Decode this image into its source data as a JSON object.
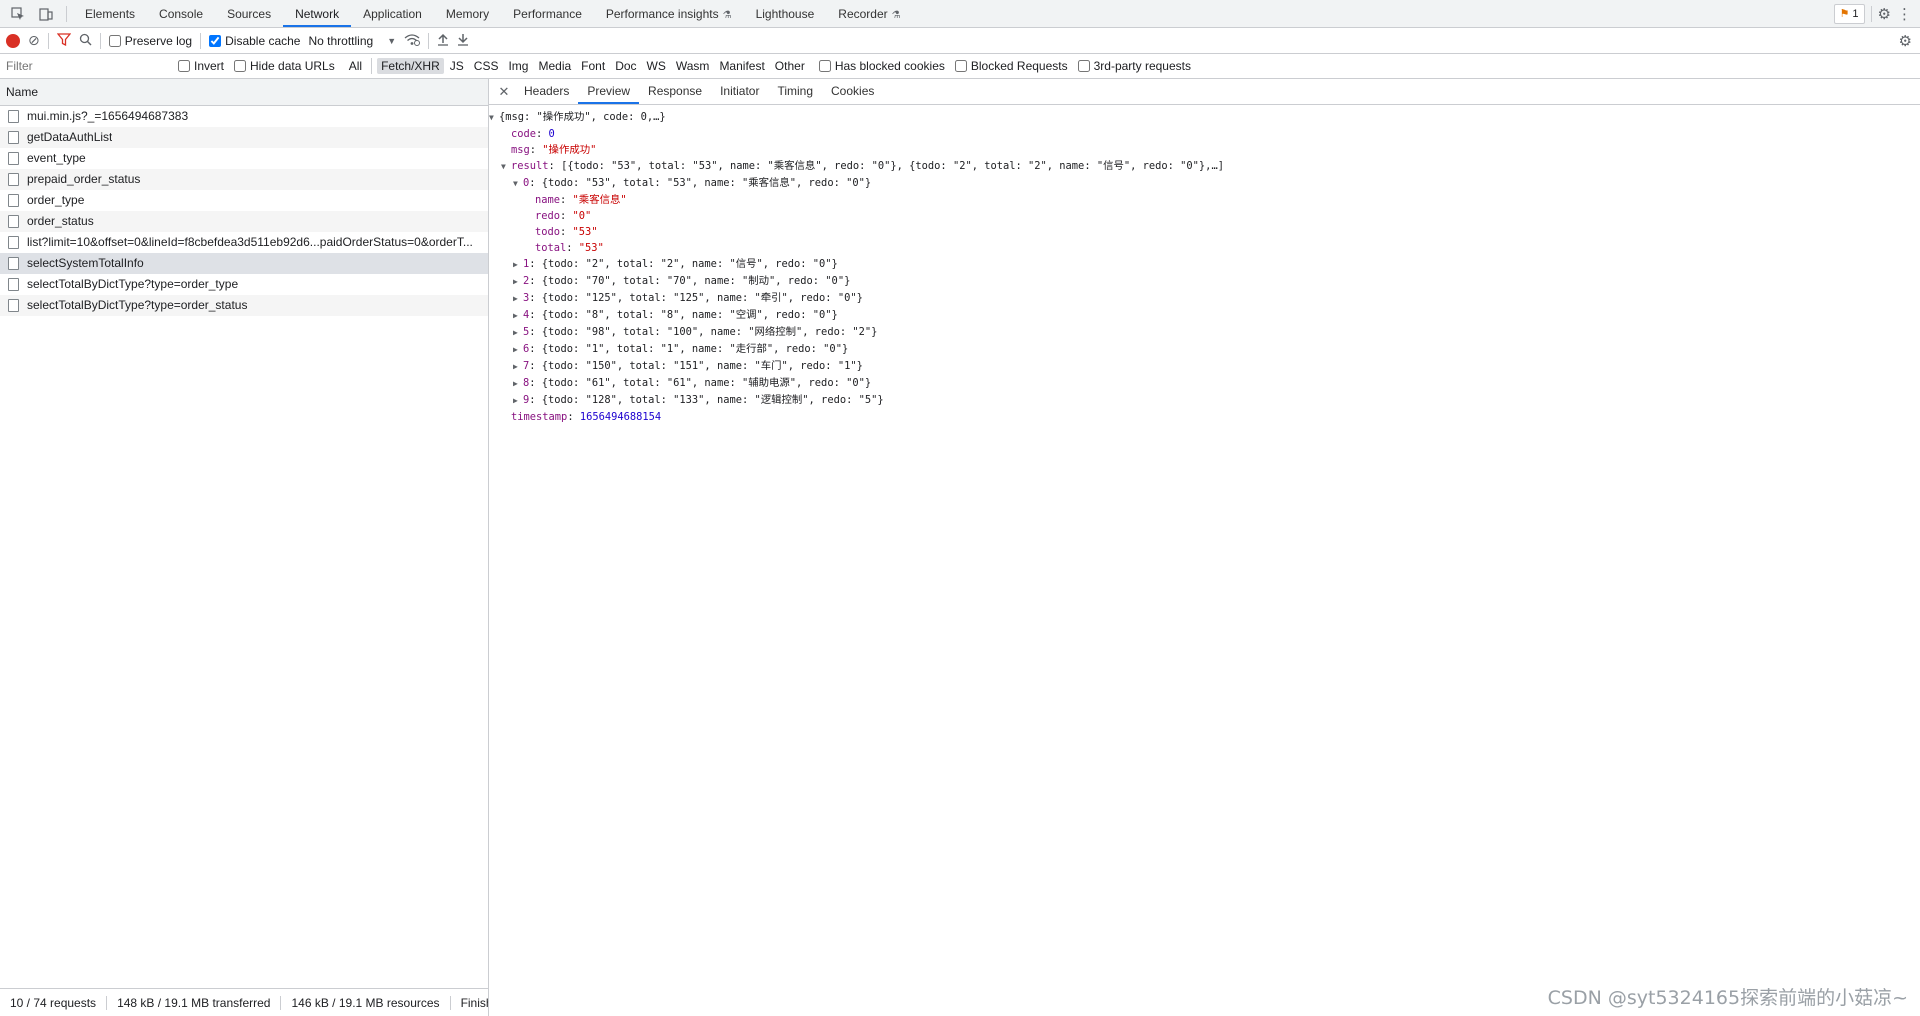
{
  "tabs": [
    {
      "label": "Elements"
    },
    {
      "label": "Console"
    },
    {
      "label": "Sources"
    },
    {
      "label": "Network",
      "active": true
    },
    {
      "label": "Application"
    },
    {
      "label": "Memory"
    },
    {
      "label": "Performance"
    },
    {
      "label": "Performance insights",
      "beta": true
    },
    {
      "label": "Lighthouse"
    },
    {
      "label": "Recorder",
      "beta": true
    }
  ],
  "issues_count": "1",
  "toolbar": {
    "preserve_log": "Preserve log",
    "disable_cache": "Disable cache",
    "throttling": "No throttling"
  },
  "filter": {
    "placeholder": "Filter",
    "invert": "Invert",
    "hide_data_urls": "Hide data URLs",
    "types": [
      "All",
      "Fetch/XHR",
      "JS",
      "CSS",
      "Img",
      "Media",
      "Font",
      "Doc",
      "WS",
      "Wasm",
      "Manifest",
      "Other"
    ],
    "selected_type": "Fetch/XHR",
    "has_blocked_cookies": "Has blocked cookies",
    "blocked_requests": "Blocked Requests",
    "third_party": "3rd-party requests"
  },
  "requests": {
    "header": "Name",
    "items": [
      "mui.min.js?_=1656494687383",
      "getDataAuthList",
      "event_type",
      "prepaid_order_status",
      "order_type",
      "order_status",
      "list?limit=10&offset=0&lineId=f8cbefdea3d511eb92d6...paidOrderStatus=0&orderT...",
      "selectSystemTotalInfo",
      "selectTotalByDictType?type=order_type",
      "selectTotalByDictType?type=order_status"
    ],
    "selected_index": 7
  },
  "status": {
    "requests": "10 / 74 requests",
    "transferred": "148 kB / 19.1 MB transferred",
    "resources": "146 kB / 19.1 MB resources",
    "finish": "Finish:"
  },
  "detail_tabs": [
    "Headers",
    "Preview",
    "Response",
    "Initiator",
    "Timing",
    "Cookies"
  ],
  "detail_active": "Preview",
  "preview": {
    "root_summary": "{msg: \"操作成功\", code: 0,…}",
    "code": "0",
    "msg": "\"操作成功\"",
    "result_summary": "[{todo: \"53\", total: \"53\", name: \"乘客信息\", redo: \"0\"}, {todo: \"2\", total: \"2\", name: \"信号\", redo: \"0\"},…]",
    "item0_summary": "{todo: \"53\", total: \"53\", name: \"乘客信息\", redo: \"0\"}",
    "item0": {
      "name": "\"乘客信息\"",
      "redo": "\"0\"",
      "todo": "\"53\"",
      "total": "\"53\""
    },
    "items": [
      {
        "idx": "1",
        "summary": "{todo: \"2\", total: \"2\", name: \"信号\", redo: \"0\"}"
      },
      {
        "idx": "2",
        "summary": "{todo: \"70\", total: \"70\", name: \"制动\", redo: \"0\"}"
      },
      {
        "idx": "3",
        "summary": "{todo: \"125\", total: \"125\", name: \"牵引\", redo: \"0\"}"
      },
      {
        "idx": "4",
        "summary": "{todo: \"8\", total: \"8\", name: \"空调\", redo: \"0\"}"
      },
      {
        "idx": "5",
        "summary": "{todo: \"98\", total: \"100\", name: \"网络控制\", redo: \"2\"}"
      },
      {
        "idx": "6",
        "summary": "{todo: \"1\", total: \"1\", name: \"走行部\", redo: \"0\"}"
      },
      {
        "idx": "7",
        "summary": "{todo: \"150\", total: \"151\", name: \"车门\", redo: \"1\"}"
      },
      {
        "idx": "8",
        "summary": "{todo: \"61\", total: \"61\", name: \"辅助电源\", redo: \"0\"}"
      },
      {
        "idx": "9",
        "summary": "{todo: \"128\", total: \"133\", name: \"逻辑控制\", redo: \"5\"}"
      }
    ],
    "timestamp": "1656494688154"
  },
  "watermark": "CSDN @syt5324165探索前端的小菇凉~",
  "colors": {
    "accent": "#1a73e8",
    "record": "#d93025",
    "key": "#881280",
    "string": "#c80000",
    "number": "#1c00cf"
  }
}
